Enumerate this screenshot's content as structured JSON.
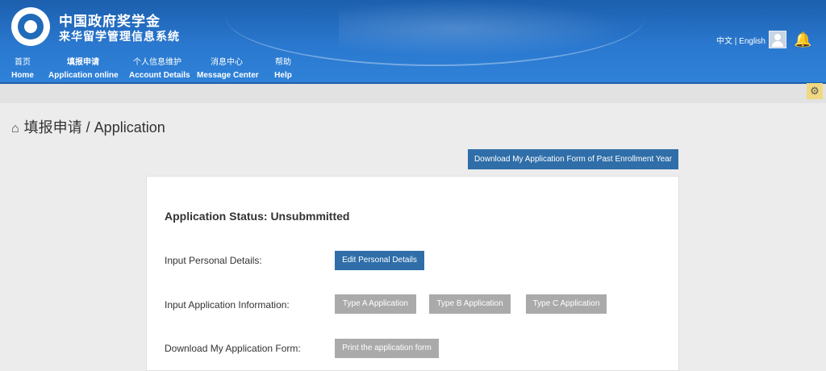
{
  "header": {
    "title_line1": "中国政府奖学金",
    "title_line2": "来华留学管理信息系统",
    "lang_text": "中文 | English"
  },
  "nav": [
    {
      "cn": "首页",
      "en": "Home"
    },
    {
      "cn": "填报申请",
      "en": "Application online"
    },
    {
      "cn": "个人信息维护",
      "en": "Account Details"
    },
    {
      "cn": "消息中心",
      "en": "Message Center"
    },
    {
      "cn": "帮助",
      "en": "Help"
    }
  ],
  "page": {
    "title": "填报申请 / Application",
    "download_past": "Download My Application Form of Past Enrollment Year",
    "status": "Application Status: Unsubmmitted",
    "rows": {
      "personal_label": "Input Personal Details:",
      "personal_btn": "Edit Personal Details",
      "app_info_label": "Input Application Information:",
      "type_a": "Type A Application",
      "type_b": "Type B Application",
      "type_c": "Type C Application",
      "download_label": "Download My Application Form:",
      "print_btn": "Print the application form"
    }
  },
  "icons": {
    "home": "home-icon",
    "gear": "gear-icon",
    "bell": "bell-icon",
    "user": "user-icon"
  },
  "colors": {
    "header_blue": "#2a78cf",
    "primary_button": "#2f6ea8",
    "disabled_button": "#aaaaaa",
    "gear_bg": "#f0d982"
  }
}
